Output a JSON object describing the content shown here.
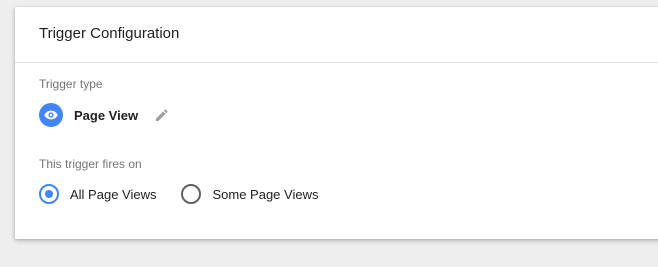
{
  "card": {
    "title": "Trigger Configuration"
  },
  "trigger_type": {
    "label": "Trigger type",
    "selected": "Page View",
    "icon": "eye-icon",
    "edit_icon": "pencil-icon",
    "accent_color": "#4285f4"
  },
  "fires_on": {
    "label": "This trigger fires on",
    "options": [
      {
        "label": "All Page Views",
        "checked": true
      },
      {
        "label": "Some Page Views",
        "checked": false
      }
    ]
  }
}
